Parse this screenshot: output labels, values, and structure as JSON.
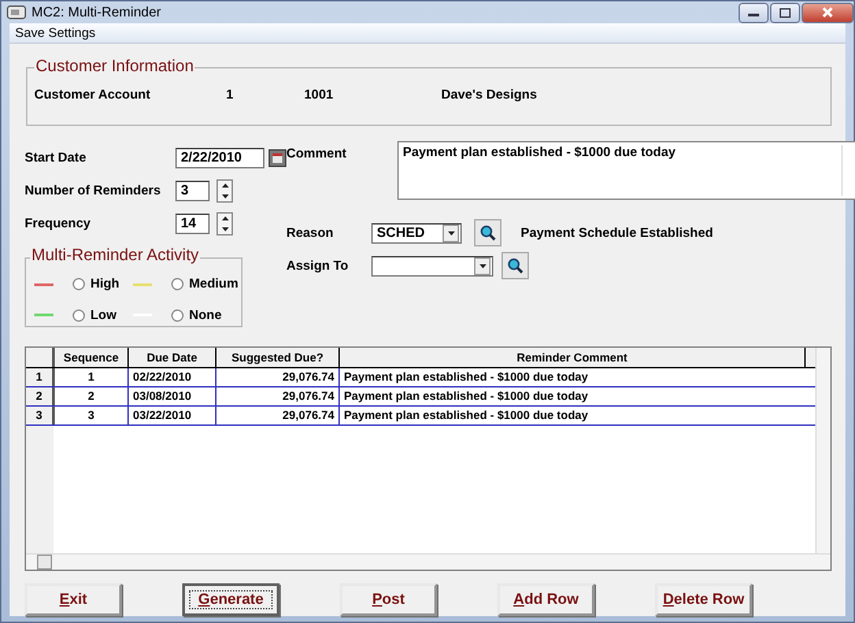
{
  "window": {
    "title": "MC2: Multi-Reminder"
  },
  "menu": [
    "Save Settings"
  ],
  "customer": {
    "title": "Customer Information",
    "label": "Customer Account",
    "number": "1",
    "account": "1001",
    "name": "Dave's Designs"
  },
  "form": {
    "start_date_label": "Start Date",
    "start_date": "2/22/2010",
    "reminders_label": "Number of Reminders",
    "reminders": "3",
    "frequency_label": "Frequency",
    "frequency": "14",
    "comment_label": "Comment",
    "comment": "Payment plan established - $1000 due today",
    "reason_label": "Reason",
    "reason": "SCHED",
    "reason_text": "Payment Schedule Established",
    "assign_label": "Assign To"
  },
  "activity": {
    "title": "Multi-Reminder Activity",
    "options": [
      {
        "label": "High",
        "color": "#e06666",
        "selected": false
      },
      {
        "label": "Medium",
        "color": "#e8e070",
        "selected": false
      },
      {
        "label": "Low",
        "color": "#70d870",
        "selected": false
      },
      {
        "label": "None",
        "color": "#ffffff",
        "selected": false
      }
    ]
  },
  "table": {
    "columns": [
      "Sequence",
      "Due Date",
      "Suggested Due?",
      "Reminder Comment"
    ],
    "rows": [
      {
        "index": "1",
        "cells": [
          "1",
          "02/22/2010",
          "29,076.74",
          "Payment plan established - $1000 due today"
        ]
      },
      {
        "index": "2",
        "cells": [
          "2",
          "03/08/2010",
          "29,076.74",
          "Payment plan established - $1000 due today"
        ]
      },
      {
        "index": "3",
        "cells": [
          "3",
          "03/22/2010",
          "29,076.74",
          "Payment plan established - $1000 due today"
        ]
      }
    ]
  },
  "buttons": [
    {
      "label": "Exit",
      "focused": false
    },
    {
      "label": "Generate",
      "focused": true
    },
    {
      "label": "Post",
      "focused": false
    },
    {
      "label": "Add Row",
      "focused": false
    },
    {
      "label": "Delete Row",
      "focused": false
    }
  ]
}
